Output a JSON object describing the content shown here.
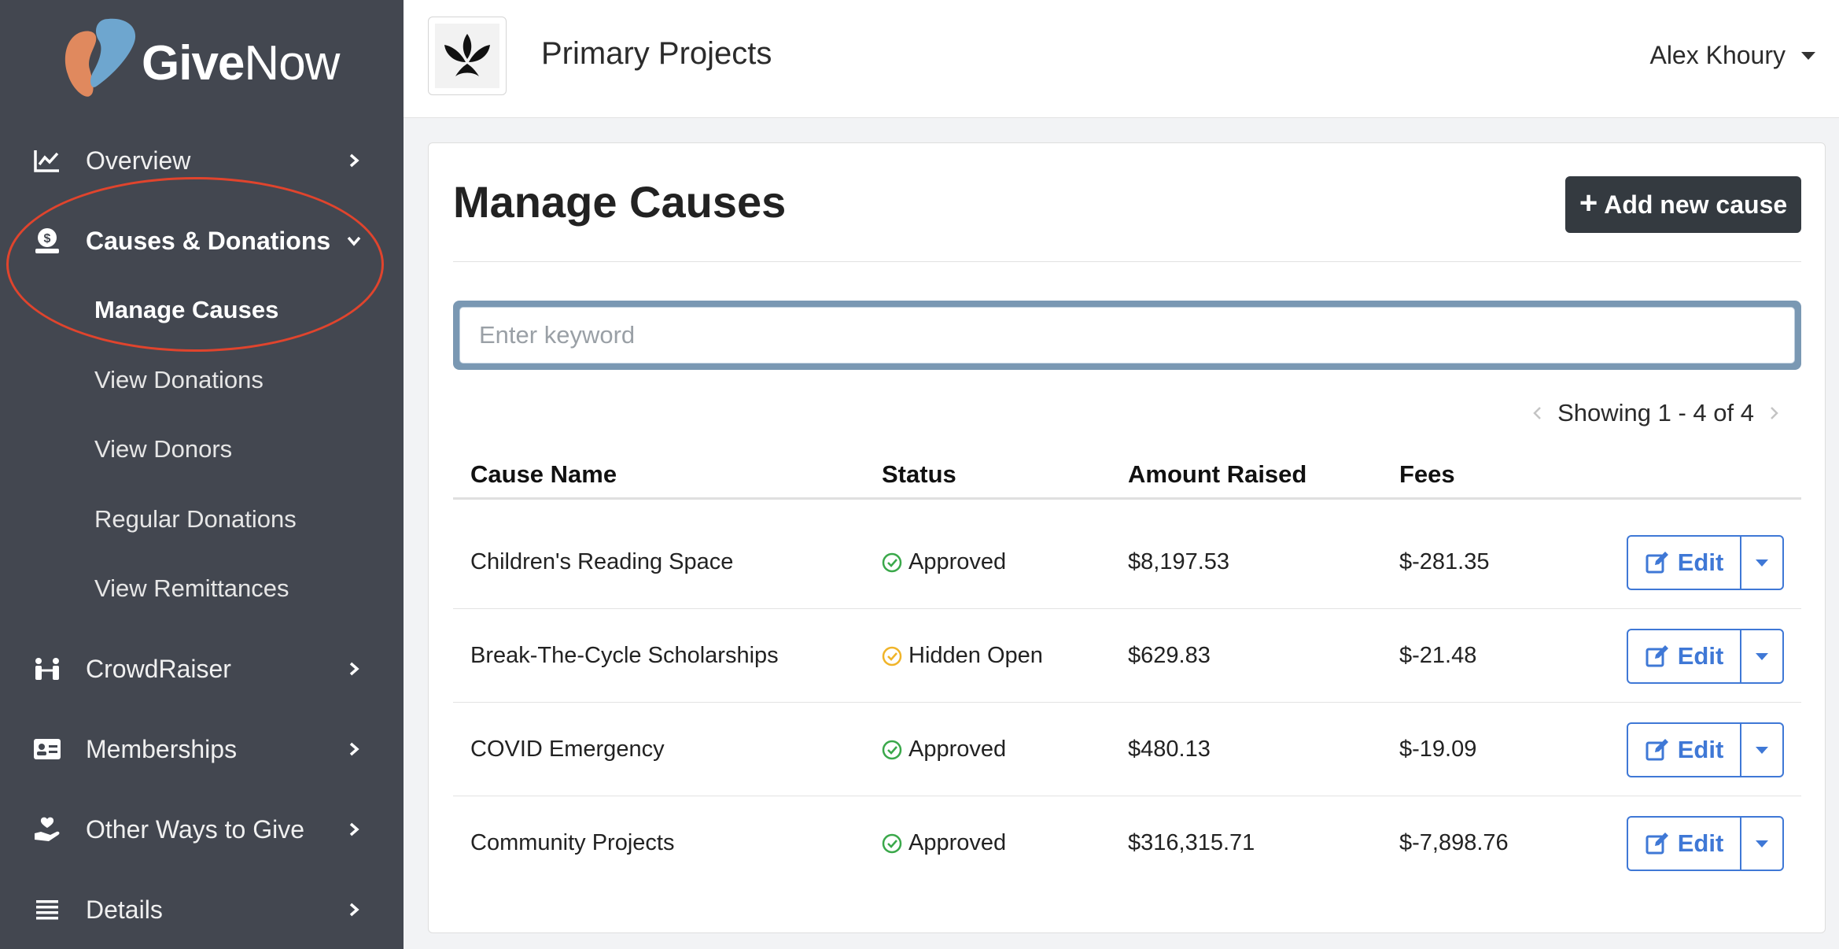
{
  "brand": {
    "logo_give": "Give",
    "logo_now": "Now",
    "accent": "#3f78d6",
    "sidebar_bg": "#434750"
  },
  "sidebar": {
    "items": [
      {
        "label": "Overview",
        "icon": "chart-line-icon"
      },
      {
        "label": "Causes & Donations",
        "icon": "donation-icon",
        "expanded": true
      },
      {
        "label": "CrowdRaiser",
        "icon": "people-icon"
      },
      {
        "label": "Memberships",
        "icon": "id-card-icon"
      },
      {
        "label": "Other Ways to Give",
        "icon": "hand-heart-icon"
      },
      {
        "label": "Details",
        "icon": "list-icon"
      }
    ],
    "subitems": [
      {
        "label": "Manage Causes",
        "active": true
      },
      {
        "label": "View Donations"
      },
      {
        "label": "View Donors"
      },
      {
        "label": "Regular Donations"
      },
      {
        "label": "View Remittances"
      }
    ]
  },
  "header": {
    "org_title": "Primary Projects",
    "user_name": "Alex Khoury"
  },
  "main": {
    "title": "Manage Causes",
    "add_button_label": "Add new cause",
    "search_placeholder": "Enter keyword",
    "pagination_text": "Showing 1 - 4 of 4",
    "columns": [
      "Cause Name",
      "Status",
      "Amount Raised",
      "Fees"
    ],
    "rows": [
      {
        "name": "Children's Reading Space",
        "status": "Approved",
        "status_color": "#3aa84a",
        "amount": "$8,197.53",
        "fees": "$-281.35"
      },
      {
        "name": "Break-The-Cycle Scholarships",
        "status": "Hidden Open",
        "status_color": "#f0b429",
        "amount": "$629.83",
        "fees": "$-21.48"
      },
      {
        "name": "COVID Emergency",
        "status": "Approved",
        "status_color": "#3aa84a",
        "amount": "$480.13",
        "fees": "$-19.09"
      },
      {
        "name": "Community Projects",
        "status": "Approved",
        "status_color": "#3aa84a",
        "amount": "$316,315.71",
        "fees": "$-7,898.76"
      }
    ],
    "edit_label": "Edit"
  }
}
